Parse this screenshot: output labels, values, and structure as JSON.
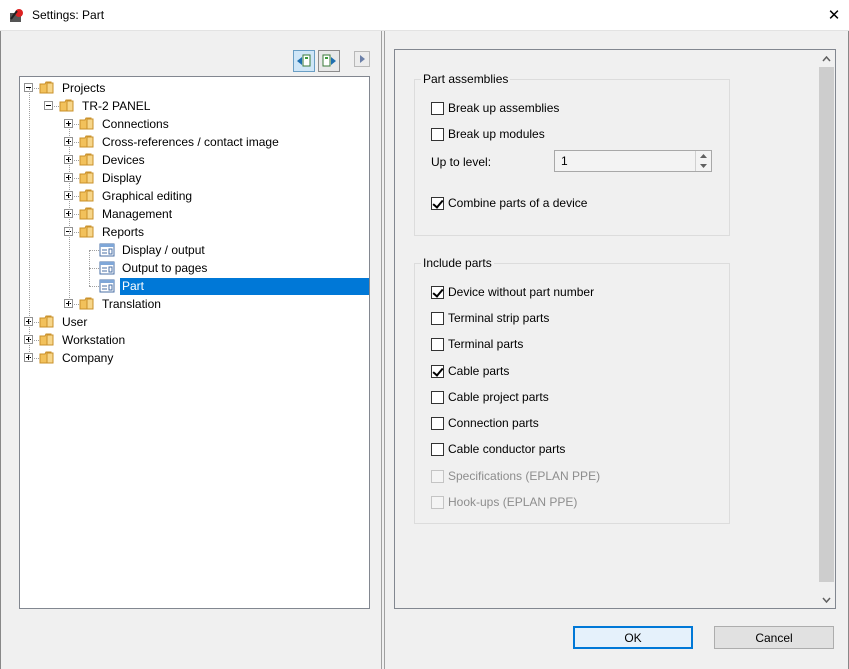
{
  "window": {
    "title": "Settings: Part",
    "close_glyph": "✕"
  },
  "tree": {
    "nodes": [
      {
        "label": "Projects",
        "level": 0,
        "expander": "minus"
      },
      {
        "label": "TR-2 PANEL",
        "level": 1,
        "expander": "minus"
      },
      {
        "label": "Connections",
        "level": 2,
        "expander": "plus"
      },
      {
        "label": "Cross-references / contact image",
        "level": 2,
        "expander": "plus"
      },
      {
        "label": "Devices",
        "level": 2,
        "expander": "plus"
      },
      {
        "label": "Display",
        "level": 2,
        "expander": "plus"
      },
      {
        "label": "Graphical editing",
        "level": 2,
        "expander": "plus"
      },
      {
        "label": "Management",
        "level": 2,
        "expander": "plus"
      },
      {
        "label": "Reports",
        "level": 2,
        "expander": "minus"
      },
      {
        "label": "Display / output",
        "level": 3,
        "expander": "none"
      },
      {
        "label": "Output to pages",
        "level": 3,
        "expander": "none"
      },
      {
        "label": "Part",
        "level": 3,
        "expander": "none",
        "selected": true
      },
      {
        "label": "Translation",
        "level": 2,
        "expander": "plus"
      },
      {
        "label": "User",
        "level": 0,
        "expander": "plus"
      },
      {
        "label": "Workstation",
        "level": 0,
        "expander": "plus"
      },
      {
        "label": "Company",
        "level": 0,
        "expander": "plus"
      }
    ]
  },
  "part_assemblies": {
    "title": "Part assemblies",
    "break_up_assemblies": {
      "label": "Break up assemblies",
      "checked": false
    },
    "break_up_modules": {
      "label": "Break up modules",
      "checked": false
    },
    "up_to_level_label": "Up to level:",
    "up_to_level_value": "1",
    "combine_parts": {
      "label": "Combine parts of a device",
      "checked": true
    }
  },
  "include_parts": {
    "title": "Include parts",
    "items": [
      {
        "label": "Device without part number",
        "checked": true,
        "disabled": false
      },
      {
        "label": "Terminal strip parts",
        "checked": false,
        "disabled": false
      },
      {
        "label": "Terminal parts",
        "checked": false,
        "disabled": false
      },
      {
        "label": "Cable parts",
        "checked": true,
        "disabled": false
      },
      {
        "label": "Cable project parts",
        "checked": false,
        "disabled": false
      },
      {
        "label": "Connection parts",
        "checked": false,
        "disabled": false
      },
      {
        "label": "Cable conductor parts",
        "checked": false,
        "disabled": false
      },
      {
        "label": "Specifications (EPLAN PPE)",
        "checked": false,
        "disabled": true
      },
      {
        "label": "Hook-ups (EPLAN PPE)",
        "checked": false,
        "disabled": true
      }
    ]
  },
  "buttons": {
    "ok": "OK",
    "cancel": "Cancel"
  },
  "colors": {
    "selection": "#0078d7",
    "folder": "#f2c15b"
  }
}
